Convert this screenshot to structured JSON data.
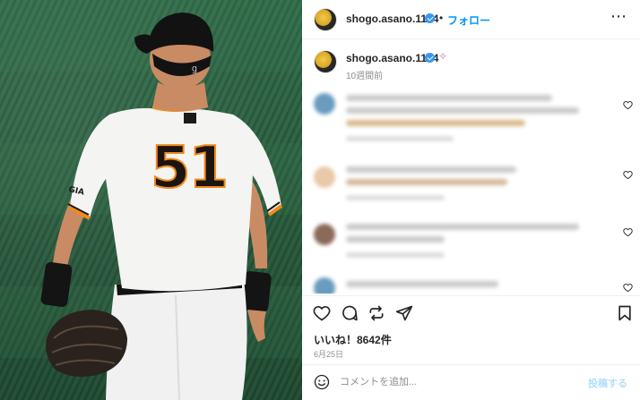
{
  "post": {
    "username": "shogo.asano.1124",
    "follow_label": "フォロー",
    "more_icon": "more-horizontal-icon",
    "jersey_number": "51",
    "caption_time": "10週間前",
    "likes_text": "いいね！8642件",
    "date_text": "6月25日"
  },
  "actions": {
    "like_icon": "heart-icon",
    "comment_icon": "comment-icon",
    "share_icon": "share-icon",
    "repost_icon": "send-icon",
    "save_icon": "bookmark-icon"
  },
  "comment_box": {
    "placeholder": "コメントを追加...",
    "post_label": "投稿する",
    "emoji_icon": "emoji-icon"
  },
  "colors": {
    "accent": "#0095f6",
    "verified": "#3897f0",
    "post_disabled": "#b2dffc",
    "uniform_orange": "#f28a1b"
  }
}
